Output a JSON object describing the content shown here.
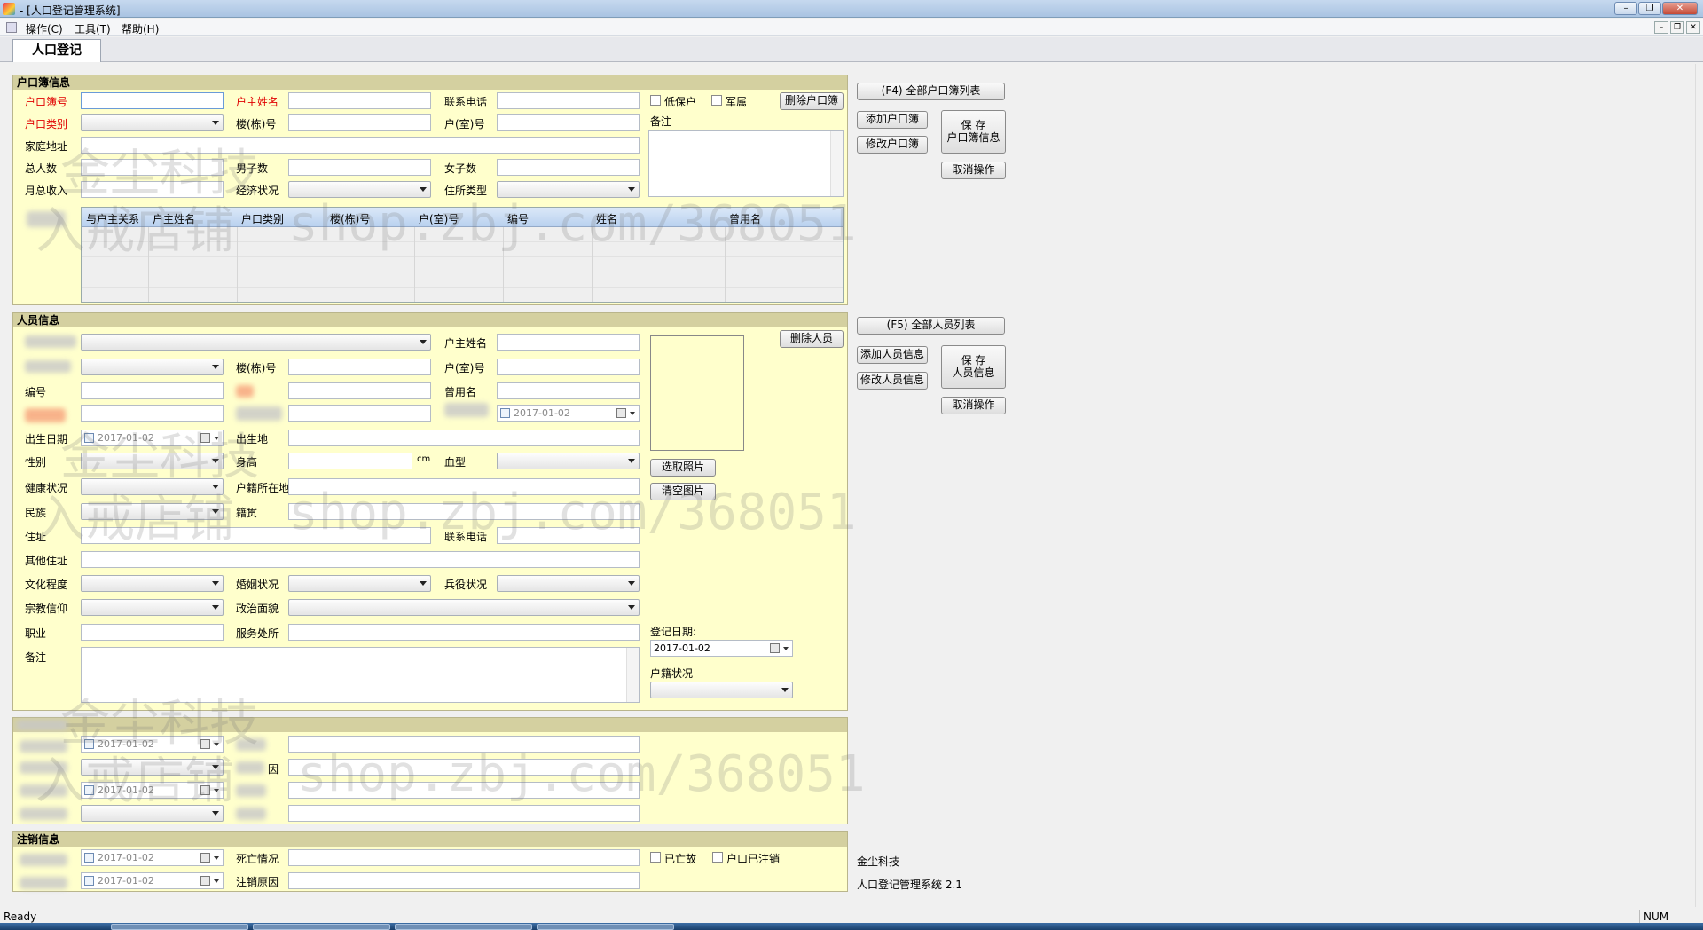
{
  "window": {
    "title": "- [人口登记管理系统]"
  },
  "menu": {
    "items": [
      "操作(C)",
      "工具(T)",
      "帮助(H)"
    ]
  },
  "tab": {
    "label": "人口登记"
  },
  "household": {
    "title": "户口簿信息",
    "labels": {
      "book_no": "户口簿号",
      "head_name": "户主姓名",
      "phone": "联系电话",
      "category": "户口类别",
      "building": "楼(栋)号",
      "room": "户(室)号",
      "address": "家庭地址",
      "total": "总人数",
      "male": "男子数",
      "female": "女子数",
      "income": "月总收入",
      "economy": "经济状况",
      "residence_type": "住所类型",
      "remark": "备注",
      "low_income": "低保户",
      "military": "军属"
    },
    "delete_button": "删除户口簿",
    "grid": {
      "columns": [
        "与户主关系",
        "户主姓名",
        "户口类别",
        "楼(栋)号",
        "户(室)号",
        "编号",
        "姓名",
        "曾用名"
      ]
    }
  },
  "household_actions": {
    "list_all": "(F4) 全部户口簿列表",
    "add": "添加户口簿",
    "edit": "修改户口簿",
    "save_line1": "保 存",
    "save_line2": "户口簿信息",
    "cancel": "取消操作"
  },
  "person": {
    "title": "人员信息",
    "labels": {
      "head_name": "户主姓名",
      "building": "楼(栋)号",
      "room": "户(室)号",
      "number": "编号",
      "former_name": "曾用名",
      "birth_date": "出生日期",
      "birthplace": "出生地",
      "gender": "性别",
      "height": "身高",
      "cm": "cm",
      "blood": "血型",
      "health": "健康状况",
      "hukou_location": "户籍所在地",
      "ethnicity": "民族",
      "origin": "籍贯",
      "address": "住址",
      "phone": "联系电话",
      "other_address": "其他住址",
      "education": "文化程度",
      "marital": "婚姻状况",
      "military_service": "兵役状况",
      "religion": "宗教信仰",
      "politics": "政治面貌",
      "occupation": "职业",
      "workplace": "服务处所",
      "register_date": "登记日期:",
      "remark": "备注",
      "hukou_status": "户籍状况"
    },
    "dates": {
      "d1": "2017-01-02",
      "birth": "2017-01-02",
      "register": "2017-01-02"
    },
    "delete_button": "删除人员",
    "choose_photo": "选取照片",
    "clear_photo": "清空图片"
  },
  "person_actions": {
    "list_all": "(F5) 全部人员列表",
    "add": "添加人员信息",
    "edit": "修改人员信息",
    "save_line1": "保 存",
    "save_line2": "人员信息",
    "cancel": "取消操作"
  },
  "migration": {
    "dates": {
      "d1": "2017-01-02",
      "d2": "2017-01-02"
    },
    "label_reason_suffix": "因"
  },
  "cancellation": {
    "title": "注销信息",
    "dates": {
      "d1": "2017-01-02",
      "d2": "2017-01-02"
    },
    "labels": {
      "death": "死亡情况",
      "reason": "注销原因",
      "deceased": "已亡故",
      "cancelled": "户口已注销"
    }
  },
  "footer": {
    "company": "金尘科技",
    "product": "人口登记管理系统 2.1"
  },
  "status": {
    "left": "Ready",
    "right": "NUM"
  },
  "watermark": {
    "cn1": "金尘科技",
    "cn2": "入戒店铺",
    "url": "shop.zbj.com/368051"
  },
  "colors": {
    "panel": "#ffffcc",
    "required": "#e00000",
    "header": "#d4d0a0"
  }
}
